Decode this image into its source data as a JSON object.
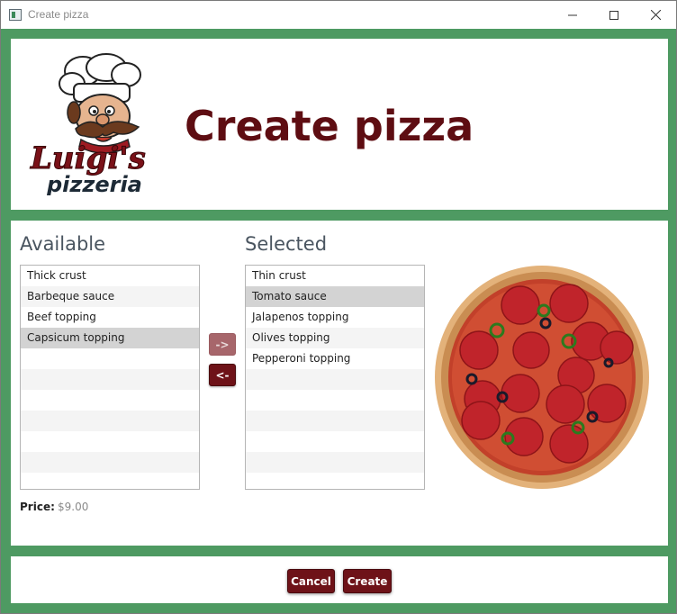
{
  "window": {
    "title": "Create pizza",
    "controls": [
      "minimize-icon",
      "maximize-icon",
      "close-icon"
    ]
  },
  "header": {
    "title": "Create pizza",
    "logo": {
      "top_text": "Luigi's",
      "bottom_text": "pizzeria"
    }
  },
  "available": {
    "heading": "Available",
    "items": [
      "Thick crust",
      "Barbeque sauce",
      "Beef topping",
      "Capsicum topping"
    ],
    "selected_index": 3
  },
  "selected": {
    "heading": "Selected",
    "items": [
      "Thin crust",
      "Tomato sauce",
      "Jalapenos topping",
      "Olives topping",
      "Pepperoni topping"
    ],
    "selected_index": 1
  },
  "move_buttons": {
    "add_label": "->",
    "remove_label": "<-"
  },
  "price": {
    "label": "Price:",
    "value": "$9.00"
  },
  "footer": {
    "cancel_label": "Cancel",
    "create_label": "Create"
  },
  "colors": {
    "brand": "#5e0d12",
    "button": "#6e1218",
    "frame": "#4e9a62"
  }
}
